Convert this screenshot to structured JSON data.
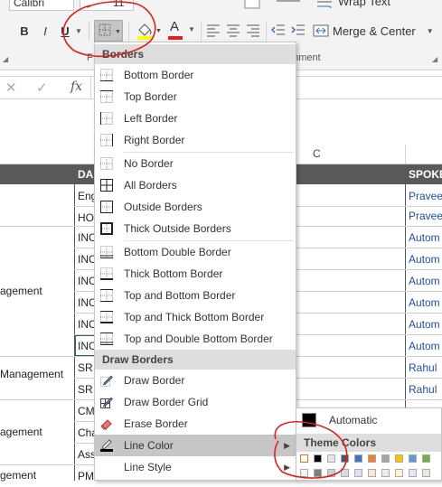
{
  "ribbon": {
    "font_name": "Calibri",
    "font_size": "11",
    "bold_label": "B",
    "italic_label": "I",
    "underline_label": "U",
    "font_color_label": "A",
    "font_group_label": "F",
    "wrap_text_label": "Wrap Text",
    "merge_center_label": "Merge & Center",
    "alignment_group_label": "gnment"
  },
  "formula_bar": {
    "cancel": "✕",
    "enter": "✓",
    "fx": "fx"
  },
  "sheet": {
    "column_c": "C",
    "header_cells": [
      "DA",
      "SPOKE"
    ],
    "left_col": [
      "agement",
      "Management",
      "agement",
      "gement"
    ],
    "d_col": [
      "Eng",
      "HO",
      "INC",
      "INC",
      "INC",
      "INC",
      "INC",
      "INC",
      "SR",
      "SR",
      "CM",
      "Cha",
      "Ass",
      "PM"
    ],
    "spoke_col": [
      "Pravee",
      "Pravee",
      "Autom",
      "Autom",
      "Autom",
      "Autom",
      "Autom",
      "Autom",
      "Rahul",
      "Rahul"
    ]
  },
  "borders_menu": {
    "header": "Borders",
    "items": [
      {
        "label": "Bottom Border",
        "icon": "bottom-border-icon"
      },
      {
        "label": "Top Border",
        "icon": "top-border-icon"
      },
      {
        "label": "Left Border",
        "icon": "left-border-icon"
      },
      {
        "label": "Right Border",
        "icon": "right-border-icon"
      },
      {
        "label": "No Border",
        "icon": "no-border-icon"
      },
      {
        "label": "All Borders",
        "icon": "all-borders-icon"
      },
      {
        "label": "Outside Borders",
        "icon": "outside-borders-icon"
      },
      {
        "label": "Thick Outside Borders",
        "icon": "thick-outside-borders-icon"
      },
      {
        "label": "Bottom Double Border",
        "icon": "bottom-double-border-icon"
      },
      {
        "label": "Thick Bottom Border",
        "icon": "thick-bottom-border-icon"
      },
      {
        "label": "Top and Bottom Border",
        "icon": "top-and-bottom-border-icon"
      },
      {
        "label": "Top and Thick Bottom Border",
        "icon": "top-and-thick-bottom-border-icon"
      },
      {
        "label": "Top and Double Bottom Border",
        "icon": "top-and-double-bottom-border-icon"
      }
    ],
    "draw_header": "Draw Borders",
    "draw_items": [
      {
        "label": "Draw Border",
        "icon": "draw-border-icon"
      },
      {
        "label": "Draw Border Grid",
        "icon": "draw-border-grid-icon"
      },
      {
        "label": "Erase Border",
        "icon": "eraser-icon"
      },
      {
        "label": "Line Color",
        "icon": "line-color-icon"
      },
      {
        "label": "Line Style",
        "icon": "line-style-icon"
      }
    ]
  },
  "line_color_submenu": {
    "automatic_label": "Automatic",
    "theme_colors_label": "Theme Colors",
    "theme_row_colors": [
      "#ffffff",
      "#000000",
      "#e7e6e6",
      "#44546a",
      "#4472c4",
      "#ed7d31",
      "#a5a5a5",
      "#ffc000",
      "#5b9bd5",
      "#70ad47"
    ]
  },
  "colors": {
    "header_fill": "#595959",
    "highlight": "#c6c6c6",
    "annotation_red": "#e0201c",
    "link_blue": "#1f4e9c"
  }
}
